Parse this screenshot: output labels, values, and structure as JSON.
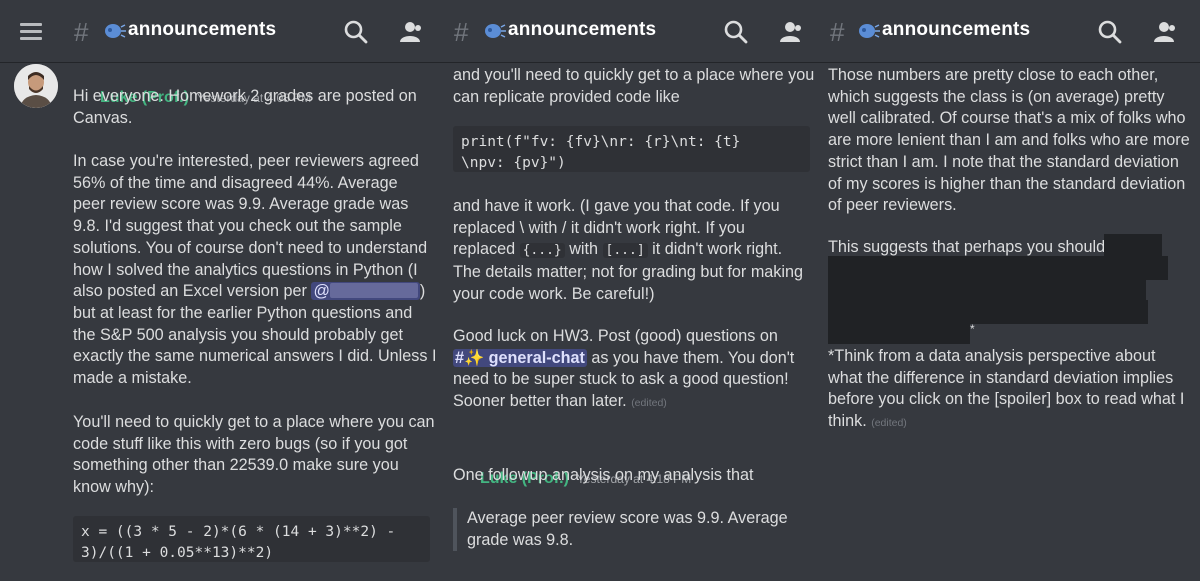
{
  "channel": {
    "name": "announcements",
    "hash": "#"
  },
  "panel1": {
    "author": "Luke (Prof.)",
    "timestamp": "Yesterday at 4:08 PM",
    "p1": "Hi everyone. Homework 2 grades are posted on\nCanvas.",
    "p2a": "In case you're interested, peer reviewers agreed\n56% of the time and disagreed 44%. Average\npeer review score was 9.9. Average grade was\n9.8. I'd suggest that you check out the sample\nsolutions. You of course don't need to understand\nhow I solved the analytics questions in Python (I\nalso posted an Excel version per ",
    "mention": "@",
    "p2b": ")\nbut at least for the earlier Python questions and\nthe S&P 500 analysis you should probably get\nexactly the same numerical answers I did. Unless I\nmade a mistake.",
    "p3": "You'll need to quickly get to a place where you can\ncode stuff like this with zero bugs (so if you got\nsomething other than 22539.0 make sure you\nknow why):",
    "code": "x = ((3 * 5 - 2)*(6 * (14 + 3)**2) -\n3)/((1 + 0.05**13)**2)"
  },
  "panel2": {
    "p1": "and you'll need to quickly get to a place where you\ncan replicate provided code like",
    "code": "print(f\"fv: {fv}\\nr: {r}\\nt: {t}\n\\npv: {pv}\")",
    "p2_l1": "and have it work. (I gave you that code. If you",
    "p2_l2a": "replaced ",
    "p2_bs": "\\",
    "p2_l2b": " with ",
    "p2_fs": "/",
    "p2_l2c": " it didn't work right. If you",
    "p2_l3a": "replaced ",
    "p2_c1": "{...}",
    "p2_l3b": " with ",
    "p2_c2": "[...]",
    "p2_l3c": " it didn't work right.",
    "p2_rest": "The details matter; not for grading but for making\nyour code work. Be careful!)",
    "p3_l1": "Good luck on HW3. Post (good) questions on",
    "chlink": "#✨ general-chat",
    "p3_l2b": " as you have them. You don't",
    "p3_rest": "need to be super stuck to ask a good question!\nSooner better than later. ",
    "edited": "(edited)",
    "author": "Luke (Prof.)",
    "timestamp": "Yesterday at 4:18 PM",
    "p4": "One followup analysis on my analysis that",
    "quote": "Average peer review score was 9.9. Average\ngrade was 9.8."
  },
  "panel3": {
    "p1": "Those numbers are pretty close to each other,\nwhich suggests the class is (on average) pretty\nwell calibrated. Of course that's a mix of folks who\nare more lenient than I am and folks who are more\nstrict than I am. I note that the standard deviation\nof my scores is higher than the standard deviation\nof peer reviewers.",
    "p2": "This suggests that perhaps you should",
    "star": "*",
    "p3": "*Think from a data analysis perspective about\nwhat the difference in standard deviation implies\nbefore you click on the [spoiler] box to read what I\nthink. ",
    "edited": "(edited)"
  },
  "colors": {
    "background": "#36393f",
    "author": "#43b581",
    "code_bg": "#2f3136",
    "spoiler": "#202225"
  },
  "icons": [
    "hamburger-icon",
    "hash-icon",
    "speaker-icon",
    "search-icon",
    "members-icon"
  ]
}
